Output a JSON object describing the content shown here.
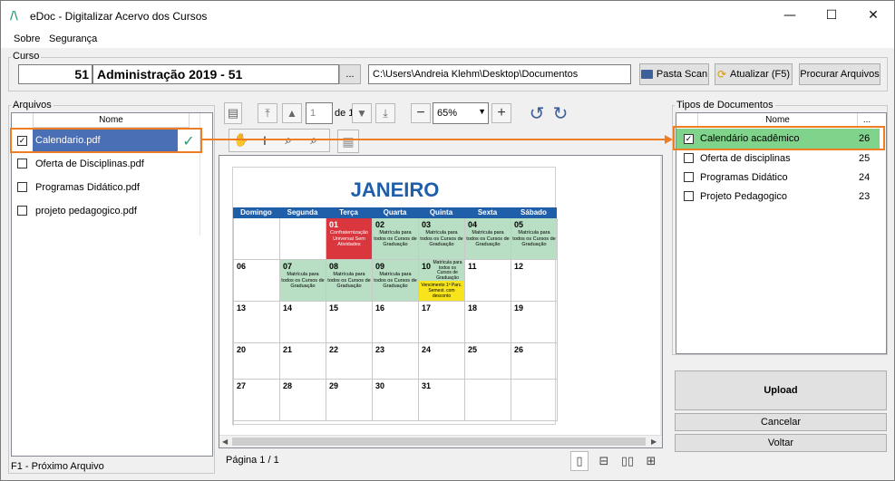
{
  "window": {
    "logo": "/\\",
    "title": "eDoc - Digitalizar Acervo dos Cursos",
    "minimize": "—",
    "maximize": "☐",
    "close": "✕"
  },
  "menu": [
    "Sobre",
    "Segurança"
  ],
  "curso": {
    "group_label": "Curso",
    "code": "51",
    "name": "Administração 2019 - 51",
    "browse_label": "...",
    "path": "C:\\Users\\Andreia Klehm\\Desktop\\Documentos",
    "pasta_scan_label": "Pasta Scan",
    "atualizar_label": "Atualizar (F5)",
    "procurar_label": "Procurar Arquivos"
  },
  "arquivos": {
    "group_label": "Arquivos",
    "column_header": "Nome",
    "items": [
      {
        "name": "Calendario.pdf",
        "checked": true,
        "selected": true,
        "status": "✓"
      },
      {
        "name": "Oferta de Disciplinas.pdf",
        "checked": false
      },
      {
        "name": "Programas Didático.pdf",
        "checked": false
      },
      {
        "name": "projeto pedagogico.pdf",
        "checked": false
      }
    ],
    "footer": "F1 - Próximo Arquivo"
  },
  "viewer": {
    "page_value": "1",
    "page_of": "de 1",
    "zoom": "65%",
    "status": "Página 1 / 1"
  },
  "calendar": {
    "title": "JANEIRO",
    "weekdays": [
      "Domingo",
      "Segunda",
      "Terça",
      "Quarta",
      "Quinta",
      "Sexta",
      "Sábado"
    ],
    "weeks": [
      [
        {
          "d": ""
        },
        {
          "d": ""
        },
        {
          "d": "01",
          "note": "Confraternização Universal Sem Atividades",
          "bg": "#d9363e",
          "fg": "#ffffff"
        },
        {
          "d": "02",
          "note": "Matrícula para todos os Cursos de Graduação",
          "bg": "#b8dfc4"
        },
        {
          "d": "03",
          "note": "Matrícula para todos os Cursos de Graduação",
          "bg": "#b8dfc4"
        },
        {
          "d": "04",
          "note": "Matrícula para todos os Cursos de Graduação",
          "bg": "#b8dfc4"
        },
        {
          "d": "05",
          "note": "Matrícula para todos os Cursos de Graduação",
          "bg": "#b8dfc4"
        }
      ],
      [
        {
          "d": "06"
        },
        {
          "d": "07",
          "note": "Matrícula para todos os Cursos de Graduação",
          "bg": "#b8dfc4"
        },
        {
          "d": "08",
          "note": "Matrícula para todos os Cursos de Graduação",
          "bg": "#b8dfc4"
        },
        {
          "d": "09",
          "note": "Matrícula para todos os Cursos de Graduação",
          "bg": "#b8dfc4"
        },
        {
          "d": "10",
          "note": "Matrícula para todos os Cursos de Graduação",
          "note2": "Vencimento 1ª Parc. Semest. com desconto",
          "bg": "#b8dfc4"
        },
        {
          "d": "11"
        },
        {
          "d": "12"
        }
      ],
      [
        {
          "d": "13"
        },
        {
          "d": "14"
        },
        {
          "d": "15"
        },
        {
          "d": "16"
        },
        {
          "d": "17"
        },
        {
          "d": "18"
        },
        {
          "d": "19"
        }
      ],
      [
        {
          "d": "20"
        },
        {
          "d": "21"
        },
        {
          "d": "22"
        },
        {
          "d": "23"
        },
        {
          "d": "24"
        },
        {
          "d": "25"
        },
        {
          "d": "26"
        }
      ],
      [
        {
          "d": "27"
        },
        {
          "d": "28"
        },
        {
          "d": "29"
        },
        {
          "d": "30"
        },
        {
          "d": "31"
        },
        {
          "d": ""
        },
        {
          "d": ""
        }
      ]
    ]
  },
  "tipos": {
    "group_label": "Tipos de Documentos",
    "column_header": "Nome",
    "column_header_2": "...",
    "items": [
      {
        "name": "Calendário acadêmico",
        "count": "26",
        "checked": true,
        "selected": true
      },
      {
        "name": "Oferta de disciplinas",
        "count": "25",
        "checked": false
      },
      {
        "name": "Programas Didático",
        "count": "24",
        "checked": false
      },
      {
        "name": "Projeto Pedagogico",
        "count": "23",
        "checked": false
      }
    ]
  },
  "actions": {
    "upload": "Upload",
    "cancelar": "Cancelar",
    "voltar": "Voltar"
  },
  "colors": {
    "accent_orange": "#ee7d24",
    "selection_blue": "#4a6fb5",
    "selection_green": "#7fd38a",
    "calendar_header": "#1f5ea8",
    "check_green": "#2a9d6b"
  }
}
